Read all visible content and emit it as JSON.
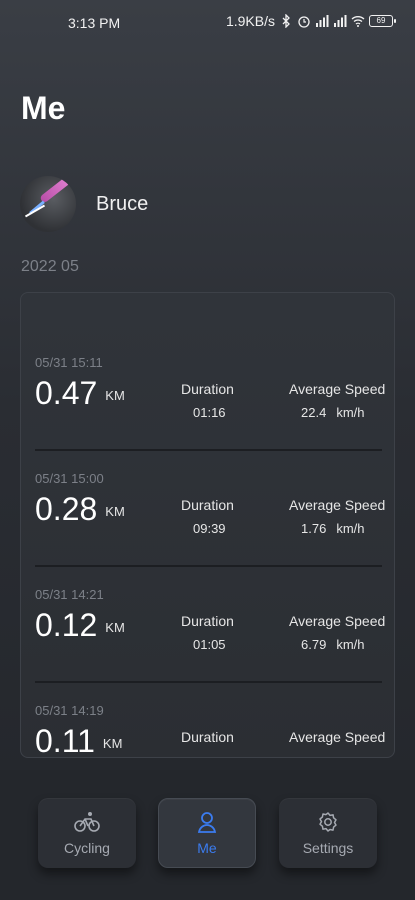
{
  "status_bar": {
    "time": "3:13 PM",
    "net_speed": "1.9KB/s",
    "battery": "69"
  },
  "page": {
    "title": "Me"
  },
  "profile": {
    "name": "Bruce"
  },
  "month_label": "2022 05",
  "records": [
    {
      "datetime": "05/31 15:11",
      "distance": "0.47",
      "unit": "KM",
      "duration_label": "Duration",
      "duration": "01:16",
      "speed_label": "Average Speed",
      "speed": "22.4",
      "speed_unit": "km/h"
    },
    {
      "datetime": "05/31 15:00",
      "distance": "0.28",
      "unit": "KM",
      "duration_label": "Duration",
      "duration": "09:39",
      "speed_label": "Average Speed",
      "speed": "1.76",
      "speed_unit": "km/h"
    },
    {
      "datetime": "05/31 14:21",
      "distance": "0.12",
      "unit": "KM",
      "duration_label": "Duration",
      "duration": "01:05",
      "speed_label": "Average Speed",
      "speed": "6.79",
      "speed_unit": "km/h"
    },
    {
      "datetime": "05/31 14:19",
      "distance": "0.11",
      "unit": "KM",
      "duration_label": "Duration",
      "duration": "",
      "speed_label": "Average Speed",
      "speed": "",
      "speed_unit": ""
    }
  ],
  "tabs": [
    {
      "label": "Cycling",
      "icon": "bicycle-icon",
      "active": false
    },
    {
      "label": "Me",
      "icon": "person-icon",
      "active": true
    },
    {
      "label": "Settings",
      "icon": "gear-icon",
      "active": false
    }
  ],
  "colors": {
    "accent": "#3b7cf0",
    "background": "#2a2d33"
  }
}
